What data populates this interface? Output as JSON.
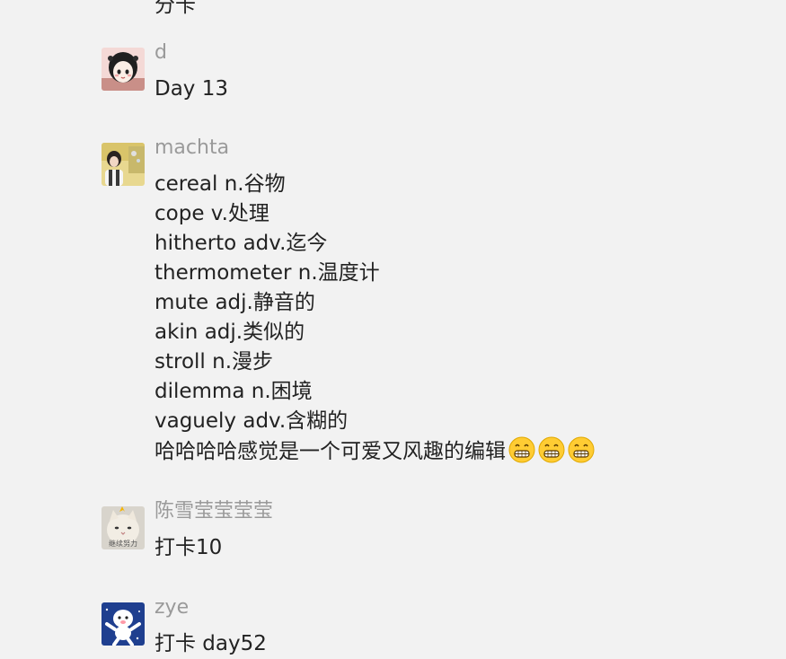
{
  "top_fragment": "分卡",
  "messages": [
    {
      "sender": "d",
      "lines": [
        "Day 13"
      ]
    },
    {
      "sender": "machta",
      "lines": [
        "cereal n.谷物",
        "cope v.处理",
        "hitherto adv.迄今",
        "thermometer n.温度计",
        "mute adj.静音的",
        "akin adj.类似的",
        "stroll n.漫步",
        "dilemma n.困境",
        "vaguely adv.含糊的",
        "哈哈哈哈感觉是一个可爱又风趣的编辑"
      ],
      "emoji": [
        "grinning-face-emoji",
        "grinning-face-emoji",
        "grinning-face-emoji"
      ]
    },
    {
      "sender": "陈雪莹莹莹莹",
      "lines": [
        "打卡10"
      ],
      "avatar_caption": "继续努力"
    },
    {
      "sender": "zye",
      "lines": [
        "打卡 day52"
      ]
    }
  ]
}
